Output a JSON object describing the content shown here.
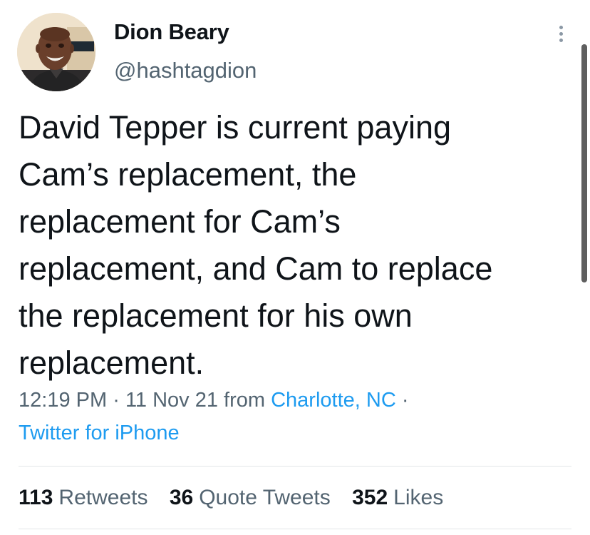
{
  "author": {
    "display_name": "Dion Beary",
    "handle": "@hashtagdion"
  },
  "tweet": {
    "text_lines": [
      "David Tepper is current paying",
      "Cam’s replacement, the",
      "replacement for Cam’s",
      "replacement, and Cam to replace",
      "the replacement for his own",
      "replacement."
    ],
    "time": "12:19 PM",
    "date": "11 Nov 21",
    "from_label": "from",
    "location": "Charlotte, NC",
    "separator": "·",
    "source": "Twitter for iPhone"
  },
  "stats": {
    "retweets_count": "113",
    "retweets_label": "Retweets",
    "quote_tweets_count": "36",
    "quote_tweets_label": "Quote Tweets",
    "likes_count": "352",
    "likes_label": "Likes"
  },
  "icons": {
    "more": "more-vertical-icon"
  },
  "colors": {
    "text": "#0f1419",
    "secondary": "#536471",
    "link": "#1d9bf0"
  }
}
